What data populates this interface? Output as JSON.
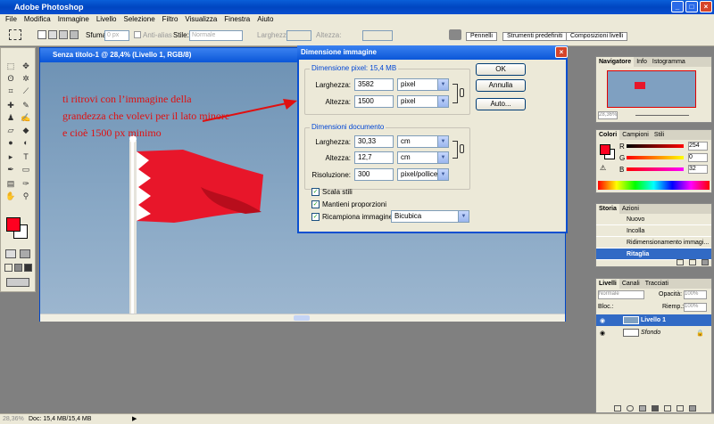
{
  "app": {
    "title": "Adobe Photoshop"
  },
  "menu": [
    "File",
    "Modifica",
    "Immagine",
    "Livello",
    "Selezione",
    "Filtro",
    "Visualizza",
    "Finestra",
    "Aiuto"
  ],
  "options": {
    "sfuma_label": "Sfuma:",
    "sfuma_value": "0 px",
    "antialias_label": "Anti-alias",
    "stile_label": "Stile:",
    "stile_value": "Normale",
    "larghezza_label": "Larghezza:",
    "altezza_label": "Altezza:"
  },
  "palette_well": [
    "Pennelli",
    "Strumenti predefiniti",
    "Composizioni livelli"
  ],
  "document": {
    "title": "Senza titolo-1 @ 28,4% (Livello 1, RGB/8)",
    "annotation": [
      "ti ritrovi con l’immagine della",
      "grandezza che volevi per il lato minore",
      "e cioè 1500 px minimo"
    ]
  },
  "dialog": {
    "title": "Dimensione immagine",
    "pixel_group": "Dimensione pixel:",
    "pixel_size": "15,4 MB",
    "width_label": "Larghezza:",
    "width_value": "3582",
    "width_unit": "pixel",
    "height_label": "Altezza:",
    "height_value": "1500",
    "height_unit": "pixel",
    "doc_group": "Dimensioni documento",
    "doc_width_label": "Larghezza:",
    "doc_width_value": "30,33",
    "doc_width_unit": "cm",
    "doc_height_label": "Altezza:",
    "doc_height_value": "12,7",
    "doc_height_unit": "cm",
    "res_label": "Risoluzione:",
    "res_value": "300",
    "res_unit": "pixel/pollice",
    "scale_styles": "Scala stili",
    "keep_proportions": "Mantieni proporzioni",
    "resample": "Ricampiona immagine:",
    "resample_value": "Bicubica",
    "ok": "OK",
    "cancel": "Annulla",
    "auto": "Auto..."
  },
  "navigator": {
    "tabs": [
      "Navigatore",
      "Info",
      "Istogramma"
    ],
    "zoom": "28,36%"
  },
  "colors": {
    "tabs": [
      "Colori",
      "Campioni",
      "Stili"
    ],
    "r_label": "R",
    "r": "254",
    "g_label": "G",
    "g": "0",
    "b_label": "B",
    "b": "32",
    "foreground": "#fe0020"
  },
  "history": {
    "tabs": [
      "Storia",
      "Azioni"
    ],
    "items": [
      "Nuovo",
      "Incolla",
      "Ridimensionamento immagi...",
      "Ritaglia"
    ]
  },
  "layers": {
    "tabs": [
      "Livelli",
      "Canali",
      "Tracciati"
    ],
    "mode": "Normale",
    "opacity_label": "Opacità:",
    "opacity": "100%",
    "lock_label": "Bloc.:",
    "fill_label": "Riemp.:",
    "fill": "100%",
    "items": [
      "Livello 1",
      "Sfondo"
    ]
  },
  "status": {
    "zoom": "28,36%",
    "doc": "Doc: 15,4 MB/15,4 MB"
  }
}
